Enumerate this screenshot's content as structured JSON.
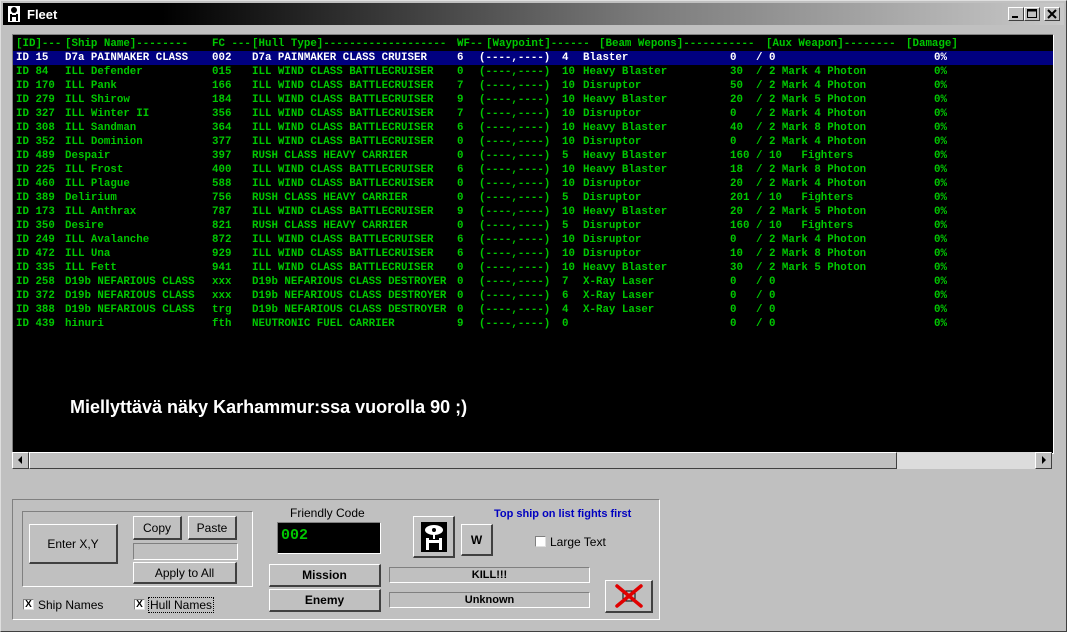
{
  "window": {
    "title": "Fleet"
  },
  "colors": {
    "list_text": "#00c800",
    "list_bg": "#000000",
    "selection_bg": "#000080",
    "hint_text": "#0000c0"
  },
  "list": {
    "header": {
      "id": "[ID]---",
      "name": "[Ship Name]--------",
      "fc": "FC ---",
      "hull": "[Hull Type]-------------------",
      "wf": "WF--",
      "waypoint": "[Waypoint]------",
      "beam": "[Beam Wepons]-----------",
      "aux": "[Aux Weapon]--------",
      "damage": "[Damage]"
    },
    "rows": [
      {
        "id": "ID 15",
        "name": "D7a PAINMAKER CLASS",
        "fc": "002",
        "hull": "D7a PAINMAKER CLASS CRUISER",
        "wf": "6",
        "wp": "(----,----)",
        "tube": "4",
        "beam": "Blaster",
        "bcount": "0",
        "aux": "/ 0",
        "damage": "0%"
      },
      {
        "id": "ID 84",
        "name": "ILL Defender",
        "fc": "015",
        "hull": "ILL WIND CLASS BATTLECRUISER",
        "wf": "0",
        "wp": "(----,----)",
        "tube": "10",
        "beam": "Heavy Blaster",
        "bcount": "30",
        "aux": "/ 2 Mark 4 Photon",
        "damage": "0%"
      },
      {
        "id": "ID 170",
        "name": "ILL Pank",
        "fc": "166",
        "hull": "ILL WIND CLASS BATTLECRUISER",
        "wf": "7",
        "wp": "(----,----)",
        "tube": "10",
        "beam": "Disruptor",
        "bcount": "50",
        "aux": "/ 2 Mark 4 Photon",
        "damage": "0%"
      },
      {
        "id": "ID 279",
        "name": "ILL Shirow",
        "fc": "184",
        "hull": "ILL WIND CLASS BATTLECRUISER",
        "wf": "9",
        "wp": "(----,----)",
        "tube": "10",
        "beam": "Heavy Blaster",
        "bcount": "20",
        "aux": "/ 2 Mark 5 Photon",
        "damage": "0%"
      },
      {
        "id": "ID 327",
        "name": "ILL Winter II",
        "fc": "356",
        "hull": "ILL WIND CLASS BATTLECRUISER",
        "wf": "7",
        "wp": "(----,----)",
        "tube": "10",
        "beam": "Disruptor",
        "bcount": "0",
        "aux": "/ 2 Mark 4 Photon",
        "damage": "0%"
      },
      {
        "id": "ID 308",
        "name": "ILL Sandman",
        "fc": "364",
        "hull": "ILL WIND CLASS BATTLECRUISER",
        "wf": "6",
        "wp": "(----,----)",
        "tube": "10",
        "beam": "Heavy Blaster",
        "bcount": "40",
        "aux": "/ 2 Mark 8 Photon",
        "damage": "0%"
      },
      {
        "id": "ID 352",
        "name": "ILL Dominion",
        "fc": "377",
        "hull": "ILL WIND CLASS BATTLECRUISER",
        "wf": "0",
        "wp": "(----,----)",
        "tube": "10",
        "beam": "Disruptor",
        "bcount": "0",
        "aux": "/ 2 Mark 4 Photon",
        "damage": "0%"
      },
      {
        "id": "ID 489",
        "name": "Despair",
        "fc": "397",
        "hull": "RUSH CLASS HEAVY CARRIER",
        "wf": "0",
        "wp": "(----,----)",
        "tube": "5",
        "beam": "Heavy Blaster",
        "bcount": "160",
        "aux": "/ 10   Fighters",
        "damage": "0%"
      },
      {
        "id": "ID 225",
        "name": "ILL Frost",
        "fc": "400",
        "hull": "ILL WIND CLASS BATTLECRUISER",
        "wf": "6",
        "wp": "(----,----)",
        "tube": "10",
        "beam": "Heavy Blaster",
        "bcount": "18",
        "aux": "/ 2 Mark 8 Photon",
        "damage": "0%"
      },
      {
        "id": "ID 460",
        "name": "ILL Plague",
        "fc": "588",
        "hull": "ILL WIND CLASS BATTLECRUISER",
        "wf": "0",
        "wp": "(----,----)",
        "tube": "10",
        "beam": "Disruptor",
        "bcount": "20",
        "aux": "/ 2 Mark 4 Photon",
        "damage": "0%"
      },
      {
        "id": "ID 389",
        "name": "Delirium",
        "fc": "756",
        "hull": "RUSH CLASS HEAVY CARRIER",
        "wf": "0",
        "wp": "(----,----)",
        "tube": "5",
        "beam": "Disruptor",
        "bcount": "201",
        "aux": "/ 10   Fighters",
        "damage": "0%"
      },
      {
        "id": "ID 173",
        "name": "ILL Anthrax",
        "fc": "787",
        "hull": "ILL WIND CLASS BATTLECRUISER",
        "wf": "9",
        "wp": "(----,----)",
        "tube": "10",
        "beam": "Heavy Blaster",
        "bcount": "20",
        "aux": "/ 2 Mark 5 Photon",
        "damage": "0%"
      },
      {
        "id": "ID 350",
        "name": "Desire",
        "fc": "821",
        "hull": "RUSH CLASS HEAVY CARRIER",
        "wf": "0",
        "wp": "(----,----)",
        "tube": "5",
        "beam": "Disruptor",
        "bcount": "160",
        "aux": "/ 10   Fighters",
        "damage": "0%"
      },
      {
        "id": "ID 249",
        "name": "ILL Avalanche",
        "fc": "872",
        "hull": "ILL WIND CLASS BATTLECRUISER",
        "wf": "6",
        "wp": "(----,----)",
        "tube": "10",
        "beam": "Disruptor",
        "bcount": "0",
        "aux": "/ 2 Mark 4 Photon",
        "damage": "0%"
      },
      {
        "id": "ID 472",
        "name": "ILL Una",
        "fc": "929",
        "hull": "ILL WIND CLASS BATTLECRUISER",
        "wf": "6",
        "wp": "(----,----)",
        "tube": "10",
        "beam": "Disruptor",
        "bcount": "10",
        "aux": "/ 2 Mark 8 Photon",
        "damage": "0%"
      },
      {
        "id": "ID 335",
        "name": "ILL Fett",
        "fc": "941",
        "hull": "ILL WIND CLASS BATTLECRUISER",
        "wf": "0",
        "wp": "(----,----)",
        "tube": "10",
        "beam": "Heavy Blaster",
        "bcount": "30",
        "aux": "/ 2 Mark 5 Photon",
        "damage": "0%"
      },
      {
        "id": "ID 258",
        "name": "D19b NEFARIOUS CLASS",
        "fc": "xxx",
        "hull": "D19b NEFARIOUS CLASS DESTROYER",
        "wf": "0",
        "wp": "(----,----)",
        "tube": "7",
        "beam": "X-Ray Laser",
        "bcount": "0",
        "aux": "/ 0",
        "damage": "0%"
      },
      {
        "id": "ID 372",
        "name": "D19b NEFARIOUS CLASS",
        "fc": "xxx",
        "hull": "D19b NEFARIOUS CLASS DESTROYER",
        "wf": "0",
        "wp": "(----,----)",
        "tube": "6",
        "beam": "X-Ray Laser",
        "bcount": "0",
        "aux": "/ 0",
        "damage": "0%"
      },
      {
        "id": "ID 388",
        "name": "D19b NEFARIOUS CLASS",
        "fc": "trg",
        "hull": "D19b NEFARIOUS CLASS DESTROYER",
        "wf": "0",
        "wp": "(----,----)",
        "tube": "4",
        "beam": "X-Ray Laser",
        "bcount": "0",
        "aux": "/ 0",
        "damage": "0%"
      },
      {
        "id": "ID 439",
        "name": "hinuri",
        "fc": "fth",
        "hull": "NEUTRONIC FUEL CARRIER",
        "wf": "9",
        "wp": "(----,----)",
        "tube": "0",
        "beam": "",
        "bcount": "0",
        "aux": "/ 0",
        "damage": "0%"
      }
    ]
  },
  "caption": "Miellyttävä näky Karhammur:ssa vuorolla 90 ;)",
  "controls": {
    "enter_xy": "Enter X,Y",
    "copy": "Copy",
    "paste": "Paste",
    "apply_all": "Apply to All",
    "ship_names": "Ship Names",
    "hull_names": "Hull Names",
    "friendly_code_label": "Friendly Code",
    "friendly_code_value": "002",
    "w_button": "W",
    "hint": "Top ship on list fights first",
    "large_text": "Large Text",
    "mission": "Mission",
    "mission_value": "KILL!!!",
    "enemy": "Enemy",
    "enemy_value": "Unknown",
    "ship_names_checked": "X",
    "hull_names_checked": "X"
  }
}
